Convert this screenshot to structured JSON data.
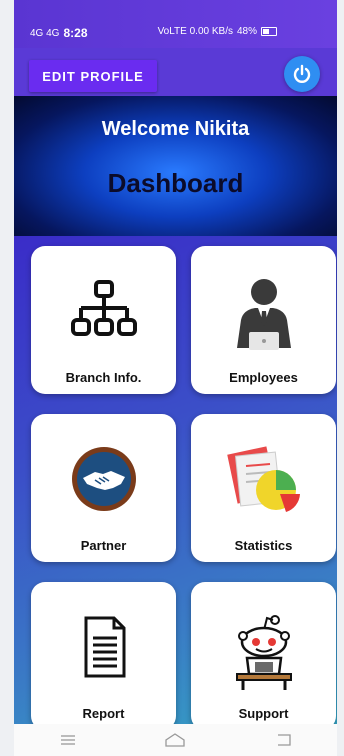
{
  "status_bar": {
    "left_signal": "4G 4G",
    "time": "8:28",
    "right_info": "VoLTE 0.00 KB/s",
    "battery": "48%"
  },
  "header": {
    "edit_profile_label": "EDIT PROFILE"
  },
  "banner": {
    "welcome": "Welcome Nikita",
    "title": "Dashboard"
  },
  "tiles": [
    {
      "label": "Branch Info.",
      "icon": "org-chart-icon"
    },
    {
      "label": "Employees",
      "icon": "employee-icon"
    },
    {
      "label": "Partner",
      "icon": "handshake-icon"
    },
    {
      "label": "Statistics",
      "icon": "statistics-icon"
    },
    {
      "label": "Report",
      "icon": "report-icon"
    },
    {
      "label": "Support",
      "icon": "support-robot-icon"
    }
  ],
  "colors": {
    "appbar": "#5a3ad6",
    "edit_button": "#6a2cf0",
    "power_button": "#2f8ef2"
  }
}
